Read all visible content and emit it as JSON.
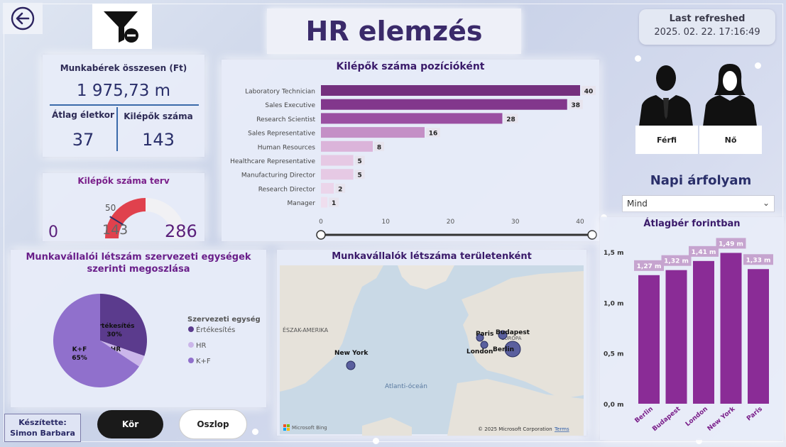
{
  "header": {
    "title": "HR elemzés",
    "refresh_label": "Last refreshed",
    "refresh_time": "2025. 02. 22. 17:16:49"
  },
  "kpi": {
    "salary_label": "Munkabérek összesen (Ft)",
    "salary_value": "1 975,73 m",
    "age_label": "Átlag életkor",
    "age_value": "37",
    "leavers_label": "Kilépők száma",
    "leavers_value": "143"
  },
  "gauge": {
    "title": "Kilépők száma terv",
    "min": "0",
    "max": "286",
    "value": "143",
    "target": "50",
    "value_num": 143,
    "target_num": 50,
    "max_num": 286,
    "fill_color": "#e0414d"
  },
  "positions_chart": {
    "title": "Kilépők száma pozícióként",
    "chart_data": {
      "type": "bar",
      "orientation": "horizontal",
      "categories": [
        "Laboratory Technician",
        "Sales Executive",
        "Research Scientist",
        "Sales Representative",
        "Human Resources",
        "Healthcare Representative",
        "Manufacturing Director",
        "Research Director",
        "Manager"
      ],
      "values": [
        40,
        38,
        28,
        16,
        8,
        5,
        5,
        2,
        1
      ],
      "xticks": [
        "0",
        "10",
        "20",
        "30",
        "40"
      ],
      "xlim": [
        0,
        40
      ],
      "colors": [
        "#74307e",
        "#82378c",
        "#9a4fa2",
        "#c48fc6",
        "#dbb4da",
        "#e6c9e4",
        "#e6c9e4",
        "#ebd5ea",
        "#efdeee"
      ]
    }
  },
  "pie_chart": {
    "title": "Munkavállalói létszám szervezeti egységek szerinti megoszlása",
    "legend_title": "Szervezeti egység",
    "chart_data": {
      "type": "pie",
      "labels": [
        "Értékesítés",
        "HR",
        "K+F"
      ],
      "values": [
        30,
        4,
        65
      ],
      "value_labels": [
        "30%",
        "4%",
        "65%"
      ],
      "colors": [
        "#5b3b8d",
        "#cbb6ea",
        "#9070cc"
      ]
    }
  },
  "map": {
    "title": "Munkavállalók létszáma területenként",
    "labels": {
      "north_america": "ÉSZAK-AMERIKA",
      "europe": "EURÓPA",
      "ocean": "Atlanti-óceán",
      "bing": "Microsoft Bing",
      "copyright": "© 2025 Microsoft Corporation",
      "terms": "Terms"
    },
    "cities": [
      "New York",
      "Paris",
      "Budapest",
      "London",
      "Berlin"
    ]
  },
  "gender": {
    "male": "Férfi",
    "female": "Nő"
  },
  "rate": {
    "title": "Napi árfolyam",
    "selected": "Mind"
  },
  "avg_salary_chart": {
    "title": "Átlagbér forintban",
    "chart_data": {
      "type": "bar",
      "categories": [
        "Berlin",
        "Budapest",
        "London",
        "New York",
        "Paris"
      ],
      "values": [
        1.27,
        1.32,
        1.41,
        1.49,
        1.33
      ],
      "value_labels": [
        "1,27 m",
        "1,32 m",
        "1,41 m",
        "1,49 m",
        "1,33 m"
      ],
      "yticks": [
        "0,0 m",
        "0,5 m",
        "1,0 m",
        "1,5 m"
      ],
      "ylim": [
        0,
        1.5
      ],
      "color": "#8a2c96"
    }
  },
  "footer": {
    "author_label": "Készítette:",
    "author_name": "Simon Barbara",
    "btn_kor": "Kör",
    "btn_oszlop": "Oszlop"
  }
}
